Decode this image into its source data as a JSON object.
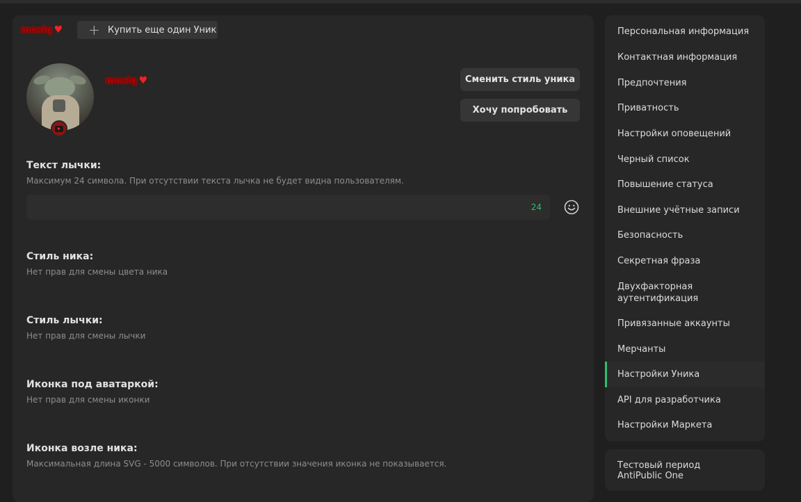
{
  "top": {
    "nick": "moxiq",
    "buy_label": "Купить еще один Уник"
  },
  "profile": {
    "nick": "moxiq",
    "change_style_label": "Сменить стиль уника",
    "try_label": "Хочу попробовать"
  },
  "sections": {
    "badge_text": {
      "title": "Текст лычки:",
      "hint": "Максимум 24 символа. При отсутствии текста лычка не будет видна пользователям.",
      "value": "",
      "counter": "24"
    },
    "nick_style": {
      "title": "Стиль ника:",
      "hint": "Нет прав для смены цвета ника"
    },
    "badge_style": {
      "title": "Стиль лычки:",
      "hint": "Нет прав для смены лычки"
    },
    "avatar_icon": {
      "title": "Иконка под аватаркой:",
      "hint": "Нет прав для смены иконки"
    },
    "nick_icon": {
      "title": "Иконка возле ника:",
      "hint": "Максимальная длина SVG - 5000 символов. При отсутствии значения иконка не показывается."
    }
  },
  "sidebar": {
    "items": [
      {
        "label": "Персональная информация"
      },
      {
        "label": "Контактная информация"
      },
      {
        "label": "Предпочтения"
      },
      {
        "label": "Приватность"
      },
      {
        "label": "Настройки оповещений"
      },
      {
        "label": "Черный список"
      },
      {
        "label": "Повышение статуса"
      },
      {
        "label": "Внешние учётные записи"
      },
      {
        "label": "Безопасность"
      },
      {
        "label": "Секретная фраза"
      },
      {
        "label": "Двухфакторная аутентификация"
      },
      {
        "label": "Привязанные аккаунты"
      },
      {
        "label": "Мерчанты"
      },
      {
        "label": "Настройки Уника",
        "active": true
      },
      {
        "label": "API для разработчика"
      },
      {
        "label": "Настройки Маркета"
      }
    ]
  },
  "sidebar2": {
    "line1": "Тестовый период",
    "line2": "AntiPublic One"
  },
  "colors": {
    "accent": "#2fbf71",
    "nick": "#8c0000",
    "heart": "#ff1e1e"
  }
}
